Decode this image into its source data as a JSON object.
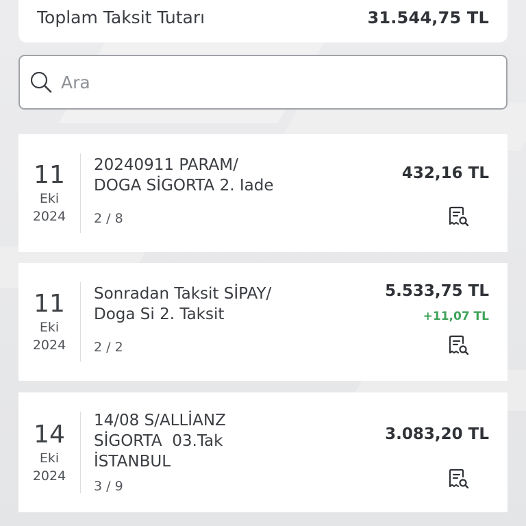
{
  "summary": {
    "label": "Toplam Taksit Tutarı",
    "value": "31.544,75 TL"
  },
  "search": {
    "placeholder": "Ara"
  },
  "transactions": [
    {
      "day": "11",
      "month": "Eki",
      "year": "2024",
      "line1": "20240911 PARAM/",
      "line2": "DOGA SİGORTA 2. Iade",
      "line3": "",
      "count": "2 / 8",
      "amount": "432,16 TL",
      "extra": ""
    },
    {
      "day": "11",
      "month": "Eki",
      "year": "2024",
      "line1": "Sonradan Taksit SİPAY/",
      "line2": "Doga Si 2. Taksit",
      "line3": "",
      "count": "2 / 2",
      "amount": "5.533,75 TL",
      "extra": "+11,07 TL"
    },
    {
      "day": "14",
      "month": "Eki",
      "year": "2024",
      "line1": "14/08 S/ALLİANZ",
      "line2": "SİGORTA  03.Tak",
      "line3": "İSTANBUL",
      "count": "3 / 9",
      "amount": "3.083,20 TL",
      "extra": ""
    }
  ],
  "colors": {
    "positive": "#3fa35a",
    "background": "#e6e7e9",
    "card": "#ffffff"
  },
  "icons": {
    "search": "search-icon",
    "receipt": "receipt-search-icon"
  }
}
